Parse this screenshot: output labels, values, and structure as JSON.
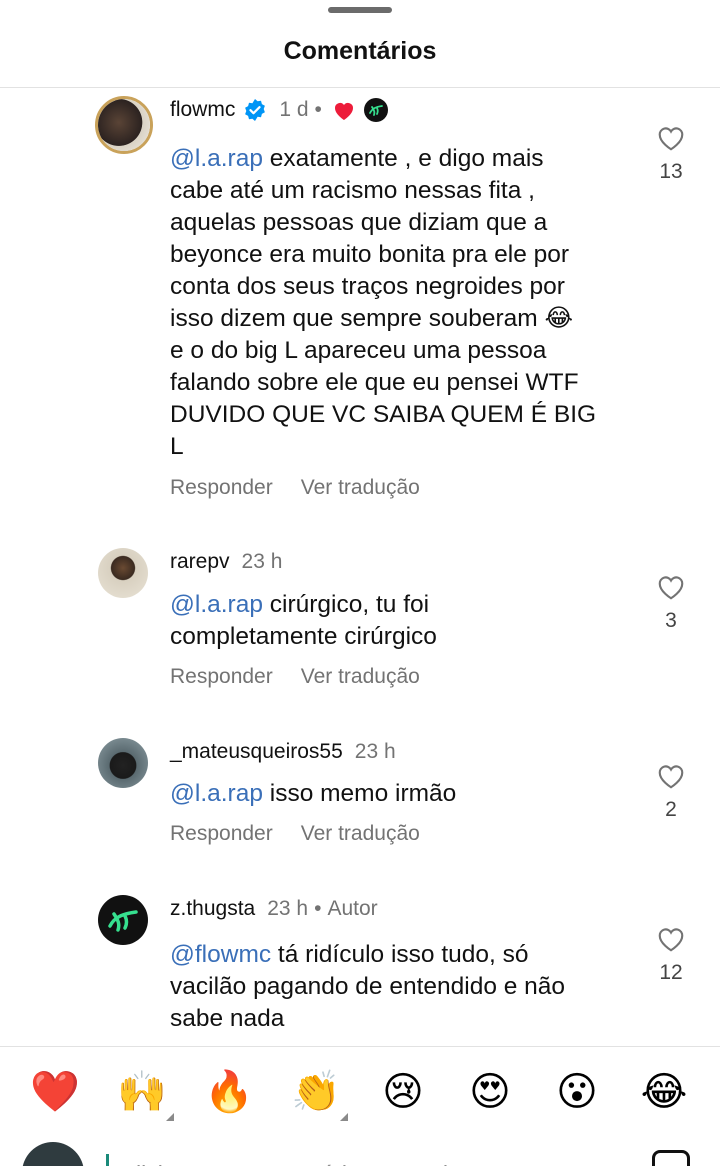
{
  "header": {
    "title": "Comentários"
  },
  "comments": [
    {
      "username": "flowmc",
      "time": "1 d",
      "body_mention": "@l.a.rap",
      "body_lines": [
        " exatamente , e digo mais",
        "cabe até um racismo nessas fita ,",
        "aquelas pessoas que diziam que a",
        "beyonce era muito bonita pra ele por",
        "conta dos seus traços negroides por",
        "isso dizem que sempre souberam 😂",
        "e o do big L apareceu uma pessoa",
        "falando sobre ele que eu pensei WTF",
        "DUVIDO QUE VC SAIBA QUEM É BIG",
        "L"
      ],
      "reply_label": "Responder",
      "translate_label": "Ver tradução",
      "likes": "13"
    },
    {
      "username": "rarepv",
      "time": "23 h",
      "body_mention": "@l.a.rap",
      "body_lines": [
        " cirúrgico, tu foi",
        "completamente cirúrgico"
      ],
      "reply_label": "Responder",
      "translate_label": "Ver tradução",
      "likes": "3"
    },
    {
      "username": "_mateusqueiros55",
      "time": "23 h",
      "body_mention": "@l.a.rap",
      "body_lines": [
        " isso memo irmão"
      ],
      "reply_label": "Responder",
      "translate_label": "Ver tradução",
      "likes": "2"
    },
    {
      "username": "z.thugsta",
      "time": "23 h",
      "author_label": "Autor",
      "body_mention": "@flowmc",
      "body_lines": [
        " tá ridículo isso tudo, só",
        "vacilão pagando de entendido e não",
        "sabe nada"
      ],
      "likes": "12"
    }
  ],
  "reactions": [
    "❤️",
    "🙌",
    "🔥",
    "👏",
    "😢",
    "😍",
    "😮",
    "😂"
  ],
  "composer": {
    "placeholder": "Adicione um comentário para z.thugsta..."
  },
  "colors": {
    "mention": "#3a6fb8",
    "verified": "#0095f6",
    "heart": "#ed1c3a",
    "secondary_text": "#737373"
  },
  "icons": [
    "verified-badge-icon",
    "liked-by-creator-heart-icon",
    "like-heart-outline-icon",
    "gif-sticker-icon"
  ]
}
